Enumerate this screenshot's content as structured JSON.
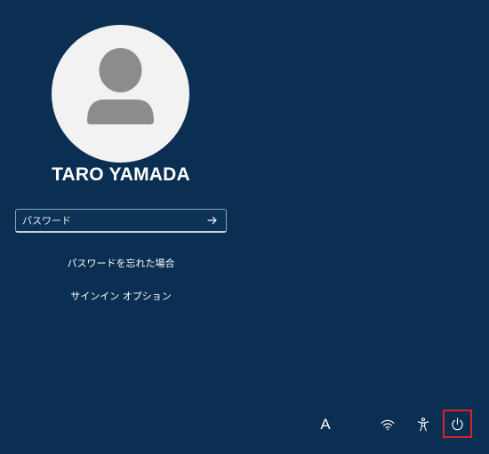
{
  "user": {
    "name": "TARO YAMADA"
  },
  "password": {
    "placeholder": "パスワード",
    "value": ""
  },
  "links": {
    "forgot_password": "パスワードを忘れた場合",
    "sign_in_options": "サインイン オプション"
  },
  "tray": {
    "input_language": "A",
    "icons": [
      "wifi-icon",
      "accessibility-icon",
      "power-icon"
    ]
  },
  "colors": {
    "background": "#0a2f52",
    "avatar_bg": "#f2f2f2",
    "avatar_silhouette": "#8c8c8c",
    "highlight": "#e02020"
  }
}
